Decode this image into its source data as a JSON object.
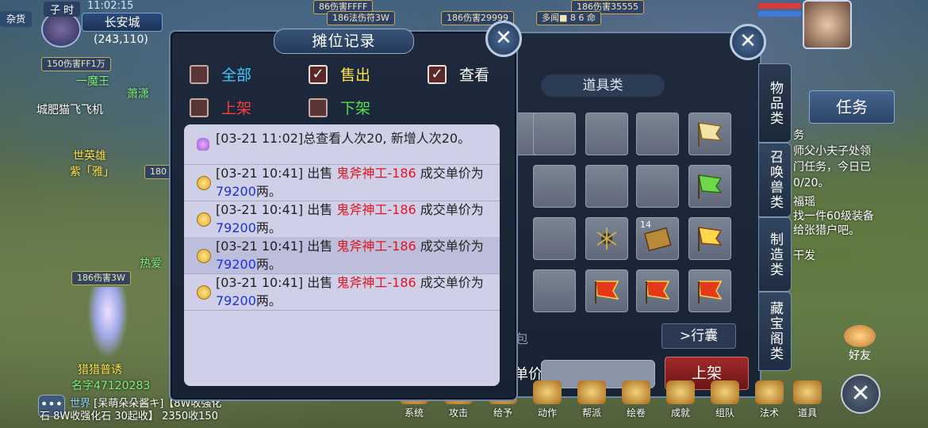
{
  "hud": {
    "time_label": "子 时",
    "clock": "11:02:15",
    "city": "长安城",
    "coords": "(243,110)",
    "side_tab": "杂货"
  },
  "scene": {
    "tags": [
      "150伤害FF1万",
      "186伤害3W",
      "180",
      "86伤害FFFF",
      "186法伤符3W",
      "186伤害29999",
      "186伤害35555",
      "多闻■ 8 6 命"
    ],
    "texts": [
      "一魔王",
      "萧潇",
      "城肥猫飞飞机",
      "世英雄",
      "紫「雅」",
      "热爱",
      "猎猎普诱",
      "名字47120283"
    ],
    "npc_name": "猎猎普诱"
  },
  "stall_log": {
    "title": "摊位记录",
    "close_symbol": "✕",
    "filters": [
      {
        "label": "全部",
        "checked": false,
        "color": "#3fc7ff"
      },
      {
        "label": "售出",
        "checked": true,
        "color": "#ffe14d"
      },
      {
        "label": "查看",
        "checked": true,
        "color": "#ffffff"
      },
      {
        "label": "上架",
        "checked": false,
        "color": "#ff3b3b"
      },
      {
        "label": "下架",
        "checked": false,
        "color": "#52e052"
      }
    ],
    "entries": [
      {
        "type": "view",
        "text": "[03-21 11:02]总查看人次20, 新增人次20。"
      },
      {
        "type": "sale",
        "prefix": "[03-21 10:41] 出售 ",
        "item": "鬼斧神工-186",
        "mid": " 成交单价为",
        "price": "79200",
        "suffix": "两。"
      },
      {
        "type": "sale",
        "prefix": "[03-21 10:41] 出售 ",
        "item": "鬼斧神工-186",
        "mid": " 成交单价为",
        "price": "79200",
        "suffix": "两。"
      },
      {
        "type": "sale",
        "prefix": "[03-21 10:41] 出售 ",
        "item": "鬼斧神工-186",
        "mid": " 成交单价为",
        "price": "79200",
        "suffix": "两。"
      },
      {
        "type": "sale",
        "prefix": "[03-21 10:41] 出售 ",
        "item": "鬼斧神工-186",
        "mid": " 成交单价为",
        "price": "79200",
        "suffix": "两。"
      }
    ]
  },
  "inventory": {
    "category": "道具类",
    "close_symbol": "✕",
    "tabs": [
      "物品类",
      "召唤兽类",
      "制造类",
      "藏宝阁类"
    ],
    "slot_count_label": "14",
    "pack_button": "行囊",
    "price_label": "单价",
    "list_button": "上架",
    "partial_label": "包"
  },
  "right_hud": {
    "task_button": "任务",
    "quest_lines": [
      "务",
      "师父小夫子处领",
      "门任务，今日已",
      "0/20。",
      "福瑶",
      "找一件60级装备",
      "给张猎户吧。",
      "干发"
    ],
    "friend_label": "好友",
    "close_symbol": "✕"
  },
  "bottom_bar": {
    "items": [
      "系统",
      "攻击",
      "给予",
      "动作",
      "帮派",
      "绘卷",
      "成就",
      "组队",
      "法术",
      "道具"
    ]
  },
  "chat": {
    "channel": "世界",
    "line1": "[呆萌朵朵酱キ]【8W收强化",
    "line2": "石 8W收强化石 30起收】 2350收150"
  }
}
